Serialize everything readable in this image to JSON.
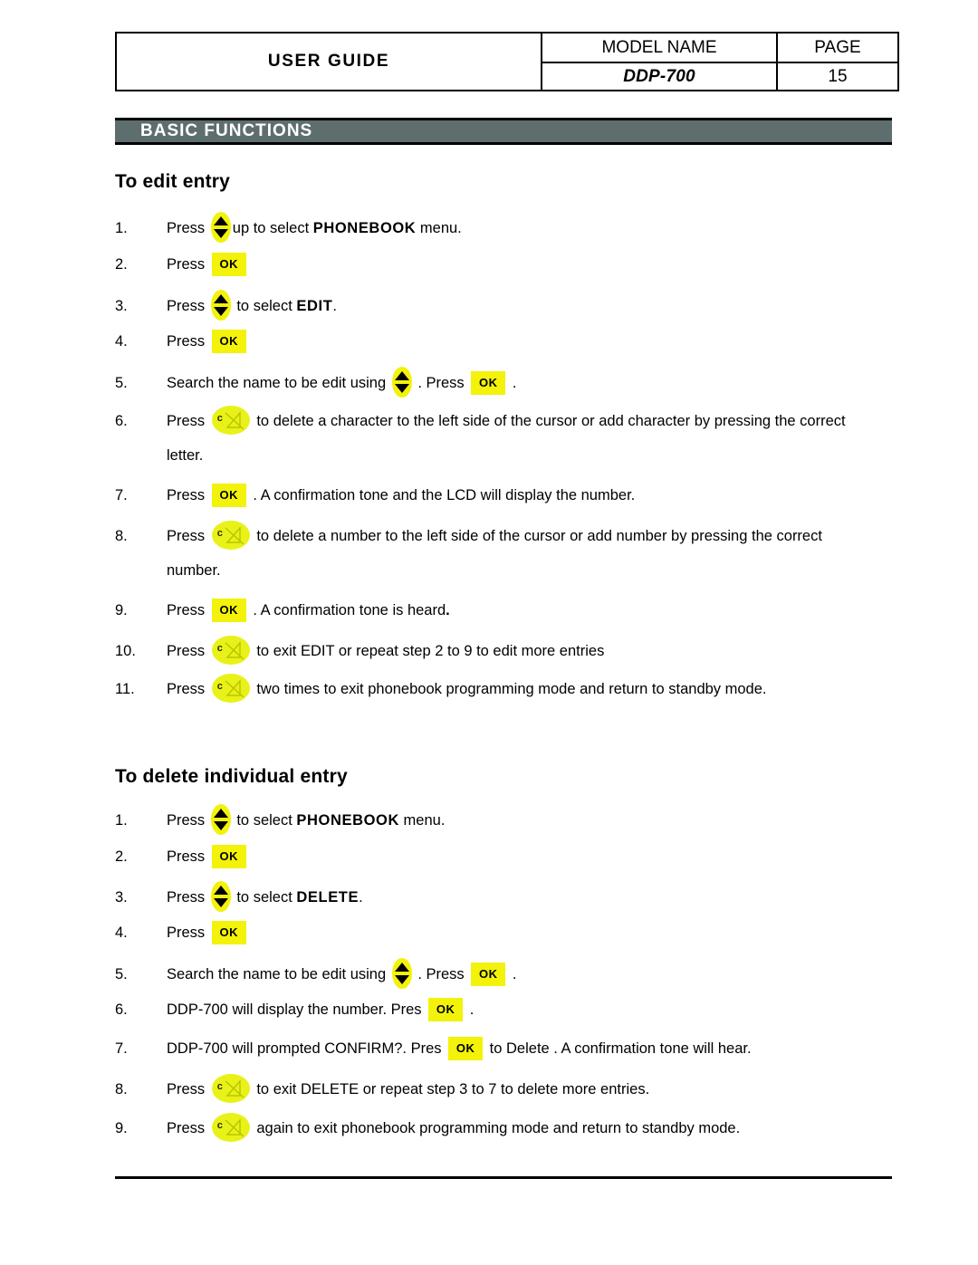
{
  "header": {
    "user_guide": "USER GUIDE",
    "model_name_label": "MODEL NAME",
    "page_label": "PAGE",
    "model_name_value": "DDP-700",
    "page_value": "15"
  },
  "banner": {
    "label": "BASIC FUNCTIONS"
  },
  "sections": [
    {
      "title": "To edit entry",
      "steps": [
        {
          "num": "1.",
          "pre": "Press ",
          "icon": "updown",
          "mid": "up  to select ",
          "strong": "PHONEBOOK",
          "post": " menu."
        },
        {
          "num": "2.",
          "pre": "Press ",
          "icon": "ok",
          "mid": "",
          "strong": "",
          "post": ""
        },
        {
          "num": "3.",
          "pre": "Press ",
          "icon": "updown",
          "mid": " to select  ",
          "strong": "EDIT",
          "post": "."
        },
        {
          "num": "4.",
          "pre": "Press ",
          "icon": "ok",
          "mid": "",
          "strong": "",
          "post": ""
        },
        {
          "num": "5.",
          "pre": "Search the name to be edit using  ",
          "icon": "updown",
          "mid": " .  Press ",
          "strong": "",
          "post": "",
          "icon2": "ok",
          "post2": " ."
        },
        {
          "num": "6.",
          "pre": "Press  ",
          "icon": "cmute",
          "mid": " to delete a character to the left side of the cursor or add character by pressing the correct",
          "strong": "",
          "post": "",
          "cont": "letter."
        },
        {
          "num": "7.",
          "pre": "Press  ",
          "icon": "ok",
          "mid": " .  A confirmation tone and the LCD will display the number.",
          "strong": "",
          "post": ""
        },
        {
          "num": "8.",
          "pre": "Press  ",
          "icon": "cmute",
          "mid": " to delete a number to the left side of the cursor or add number by pressing the correct",
          "strong": "",
          "post": "",
          "cont": "number."
        },
        {
          "num": "9.",
          "pre": "Press  ",
          "icon": "ok",
          "mid": " .  A confirmation tone is heard",
          "strong": ".",
          "post": ""
        },
        {
          "num": "10.",
          "pre": "Press  ",
          "icon": "cmute",
          "mid": " to exit EDIT  or repeat step 2 to 9 to edit more entries",
          "strong": "",
          "post": ""
        },
        {
          "num": "11.",
          "pre": "Press  ",
          "icon": "cmute",
          "mid": " two times to exit phonebook programming mode and return to standby mode.",
          "strong": "",
          "post": ""
        }
      ]
    },
    {
      "title": "To delete individual entry",
      "steps": [
        {
          "num": "1.",
          "pre": "Press ",
          "icon": "updown",
          "mid": " to select ",
          "strong": "PHONEBOOK",
          "post": " menu."
        },
        {
          "num": "2.",
          "pre": "Press ",
          "icon": "ok",
          "mid": "",
          "strong": "",
          "post": ""
        },
        {
          "num": "3.",
          "pre": "Press ",
          "icon": "updown",
          "mid": " to select ",
          "strong": "DELETE",
          "post": "."
        },
        {
          "num": "4.",
          "pre": "Press ",
          "icon": "ok",
          "mid": "",
          "strong": "",
          "post": ""
        },
        {
          "num": "5.",
          "pre": "Search the name to be edit using  ",
          "icon": "updown",
          "mid": " .  Press ",
          "strong": "",
          "post": "",
          "icon2": "ok",
          "post2": " ."
        },
        {
          "num": "6.",
          "pre": "DDP-700 will display the number.  Pres ",
          "icon": "ok",
          "mid": "    .",
          "strong": "",
          "post": ""
        },
        {
          "num": "7.",
          "pre": "DDP-700 will prompted CONFIRM?.  Pres ",
          "icon": "ok",
          "mid": "     to Delete . A confirmation tone will hear.",
          "strong": "",
          "post": ""
        },
        {
          "num": "8.",
          "pre": "Press  ",
          "icon": "cmute",
          "mid": " to exit DELETE or repeat step 3 to 7 to delete more entries.",
          "strong": "",
          "post": ""
        },
        {
          "num": "9.",
          "pre": "Press  ",
          "icon": "cmute",
          "mid": " again to exit phonebook programming mode and return to standby mode.",
          "strong": "",
          "post": ""
        }
      ]
    }
  ],
  "icons": {
    "updown": "up-down-arrow-key-icon",
    "ok": "ok-key-icon",
    "cmute": "c-mute-key-icon",
    "ok_label": "OK",
    "c_label": "c"
  },
  "colors": {
    "banner_bg": "#5e6e6e",
    "key_yellow": "#f2f20a",
    "key_green_yellow": "#e8f218"
  }
}
